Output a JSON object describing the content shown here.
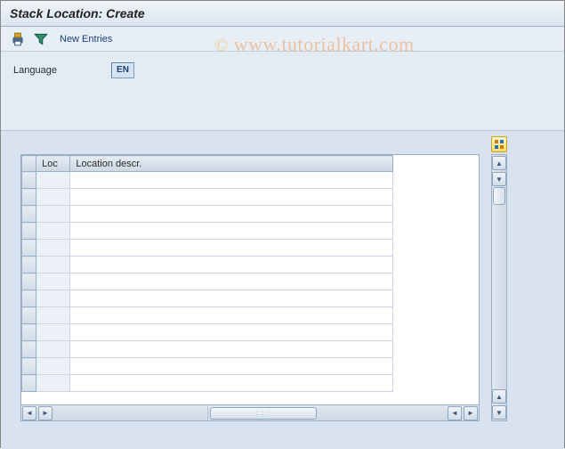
{
  "title": "Stack Location: Create",
  "toolbar": {
    "new_entries_label": "New Entries"
  },
  "form": {
    "language_label": "Language",
    "language_value": "EN"
  },
  "grid": {
    "col_rowhdr": "",
    "col_loc": "Loc",
    "col_desc": "Location descr.",
    "rows": [
      {
        "loc": "",
        "desc": ""
      },
      {
        "loc": "",
        "desc": ""
      },
      {
        "loc": "",
        "desc": ""
      },
      {
        "loc": "",
        "desc": ""
      },
      {
        "loc": "",
        "desc": ""
      },
      {
        "loc": "",
        "desc": ""
      },
      {
        "loc": "",
        "desc": ""
      },
      {
        "loc": "",
        "desc": ""
      },
      {
        "loc": "",
        "desc": ""
      },
      {
        "loc": "",
        "desc": ""
      },
      {
        "loc": "",
        "desc": ""
      },
      {
        "loc": "",
        "desc": ""
      },
      {
        "loc": "",
        "desc": ""
      }
    ]
  },
  "watermark": {
    "copy": "©",
    "text": "www.tutorialkart.com"
  }
}
